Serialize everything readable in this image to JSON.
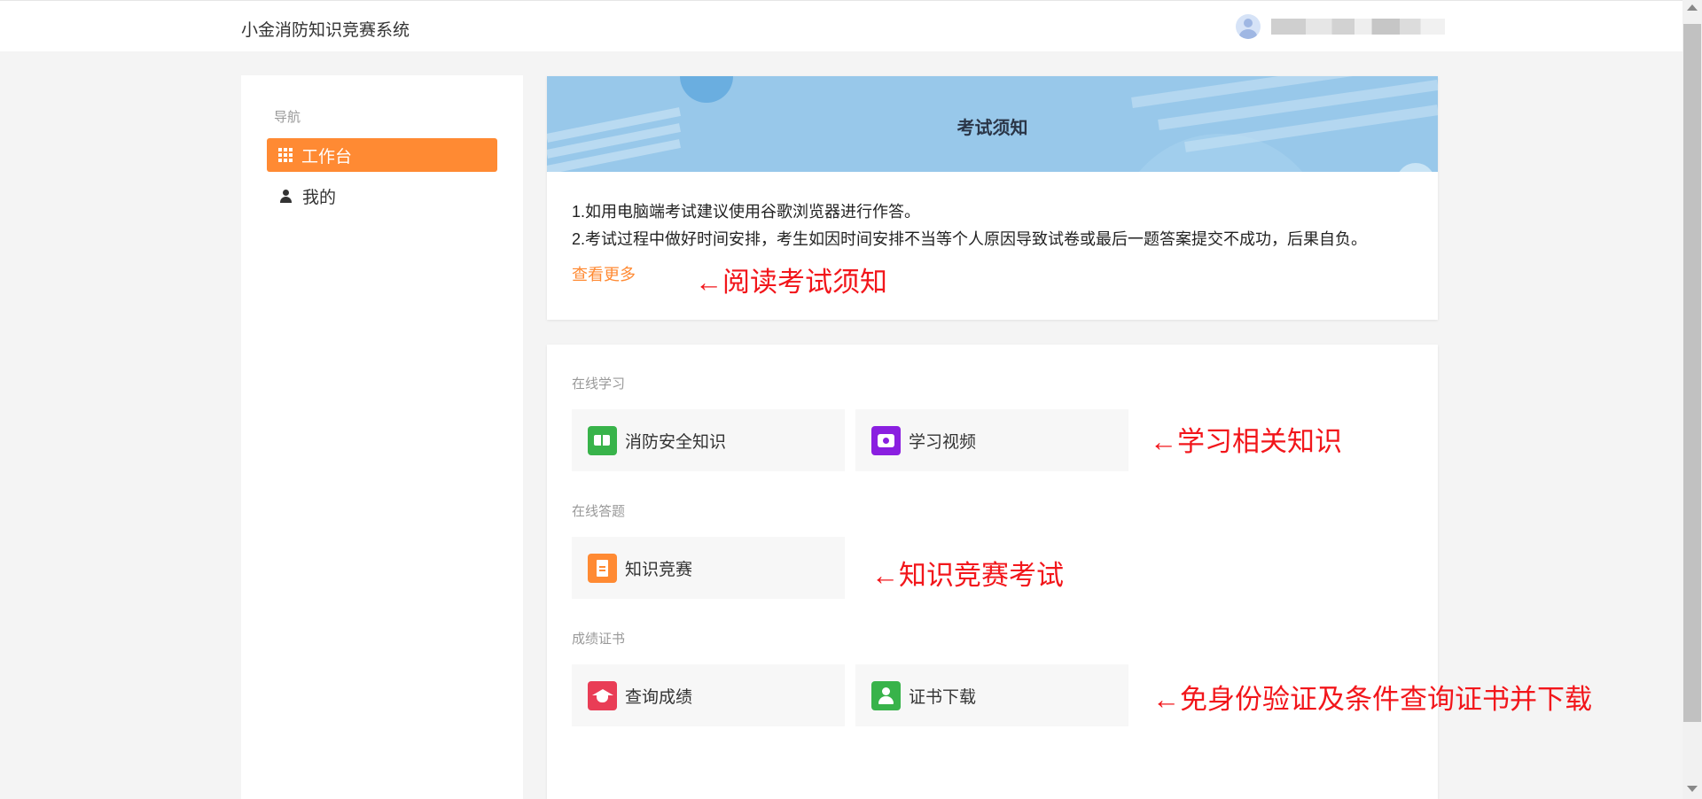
{
  "header": {
    "app_title": "小金消防知识竞赛系统"
  },
  "sidebar": {
    "heading": "导航",
    "items": [
      {
        "label": "工作台",
        "icon": "grid-icon",
        "active": true
      },
      {
        "label": "我的",
        "icon": "user-icon",
        "active": false
      }
    ]
  },
  "notice": {
    "title": "考试须知",
    "lines": [
      "1.如用电脑端考试建议使用谷歌浏览器进行作答。",
      "2.考试过程中做好时间安排，考生如因时间安排不当等个人原因导致试卷或最后一题答案提交不成功，后果自负。"
    ],
    "more_link": "查看更多"
  },
  "sections": [
    {
      "label": "在线学习",
      "tiles": [
        {
          "label": "消防安全知识",
          "icon": "book-icon",
          "color": "#38b34a"
        },
        {
          "label": "学习视频",
          "icon": "video-camera-icon",
          "color": "#8a1fe0"
        }
      ]
    },
    {
      "label": "在线答题",
      "tiles": [
        {
          "label": "知识竞赛",
          "icon": "document-icon",
          "color": "#ff8a33"
        }
      ]
    },
    {
      "label": "成绩证书",
      "tiles": [
        {
          "label": "查询成绩",
          "icon": "graduation-cap-icon",
          "color": "#e93d56"
        },
        {
          "label": "证书下载",
          "icon": "certificate-user-icon",
          "color": "#38b34a"
        }
      ]
    }
  ],
  "annotations": {
    "notice": "←阅读考试须知",
    "study": "←学习相关知识",
    "contest": "←知识竞赛考试",
    "certificate": "←免身份验证及条件查询证书并下载"
  },
  "colors": {
    "accent": "#ff8a33",
    "banner": "#98c8ea",
    "annotation": "#f2161b"
  }
}
